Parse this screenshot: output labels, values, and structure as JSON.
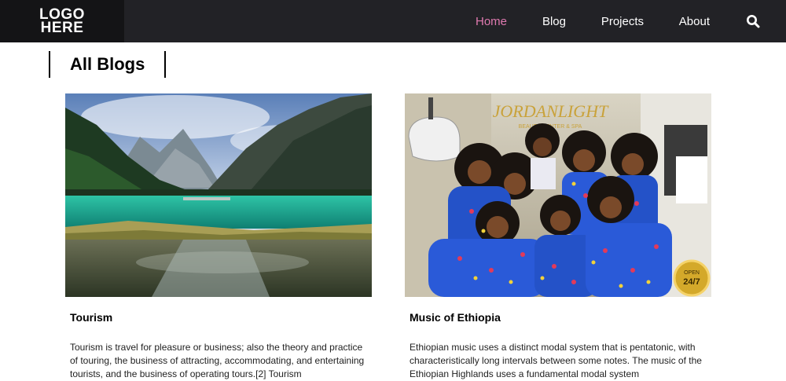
{
  "logo": {
    "line1": "LOGO",
    "line2": "HERE"
  },
  "nav": {
    "items": [
      {
        "label": "Home",
        "active": true
      },
      {
        "label": "Blog",
        "active": false
      },
      {
        "label": "Projects",
        "active": false
      },
      {
        "label": "About",
        "active": false
      }
    ],
    "search_icon": "search-icon",
    "active_color": "#e07ab0",
    "bar_color": "#222226"
  },
  "page": {
    "title": "All Blogs"
  },
  "blogs": [
    {
      "title": "Tourism",
      "excerpt": "Tourism is travel for pleasure or business; also the theory and practice of touring, the business of attracting, accommodating, and entertaining tourists, and the business of operating tours.[2] Tourism",
      "image": "mountain-lake-photo"
    },
    {
      "title": "Music of Ethiopia",
      "excerpt": "Ethiopian music uses a distinct modal system that is pentatonic, with characteristically long intervals between some notes. The music of the Ethiopian Highlands uses a fundamental modal system",
      "image": "ethiopian-dancers-photo",
      "image_text": {
        "brand": "JORDANLIGHT",
        "brand_sub": "BEAUTY CENTER & SPA",
        "badge_top": "OPEN",
        "badge_bottom": "24/7"
      }
    }
  ]
}
